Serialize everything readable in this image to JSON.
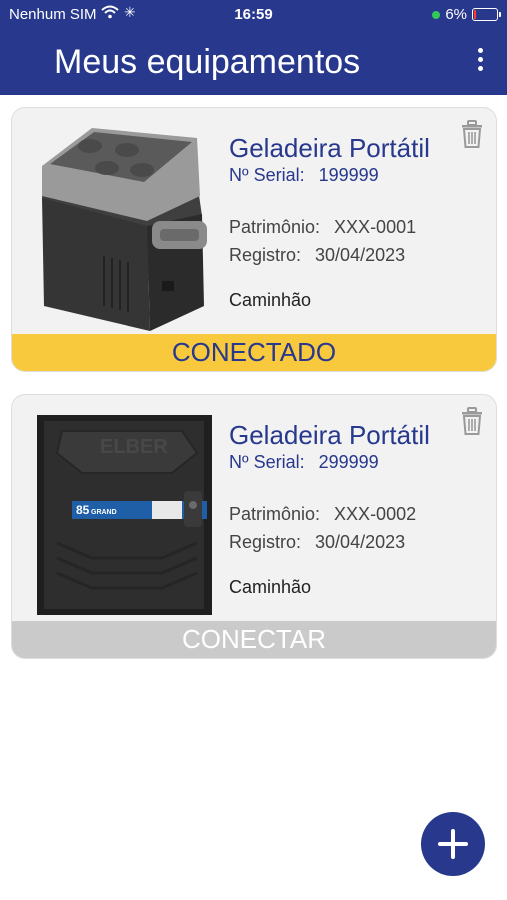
{
  "status_bar": {
    "carrier": "Nenhum SIM",
    "time": "16:59",
    "battery": "6%"
  },
  "header": {
    "title": "Meus equipamentos"
  },
  "devices": [
    {
      "name": "Geladeira Portátil",
      "serial_label": "Nº Serial:",
      "serial": "199999",
      "patrimonio_label": "Patrimônio:",
      "patrimonio": "XXX-0001",
      "registro_label": "Registro:",
      "registro": "30/04/2023",
      "location": "Caminhão",
      "status": "CONECTADO"
    },
    {
      "name": "Geladeira Portátil",
      "serial_label": "Nº Serial:",
      "serial": "299999",
      "patrimonio_label": "Patrimônio:",
      "patrimonio": "XXX-0002",
      "registro_label": "Registro:",
      "registro": "30/04/2023",
      "location": "Caminhão",
      "status": "CONECTAR",
      "image_text": {
        "brand": "ELBER",
        "model_num": "85",
        "model_name": "GRAND"
      }
    }
  ],
  "colors": {
    "primary": "#27388d",
    "connected": "#f9c93d",
    "disconnected": "#cacaca"
  },
  "icons": {
    "menu": "more-vertical-icon",
    "trash": "trash-icon",
    "add": "plus-icon"
  }
}
